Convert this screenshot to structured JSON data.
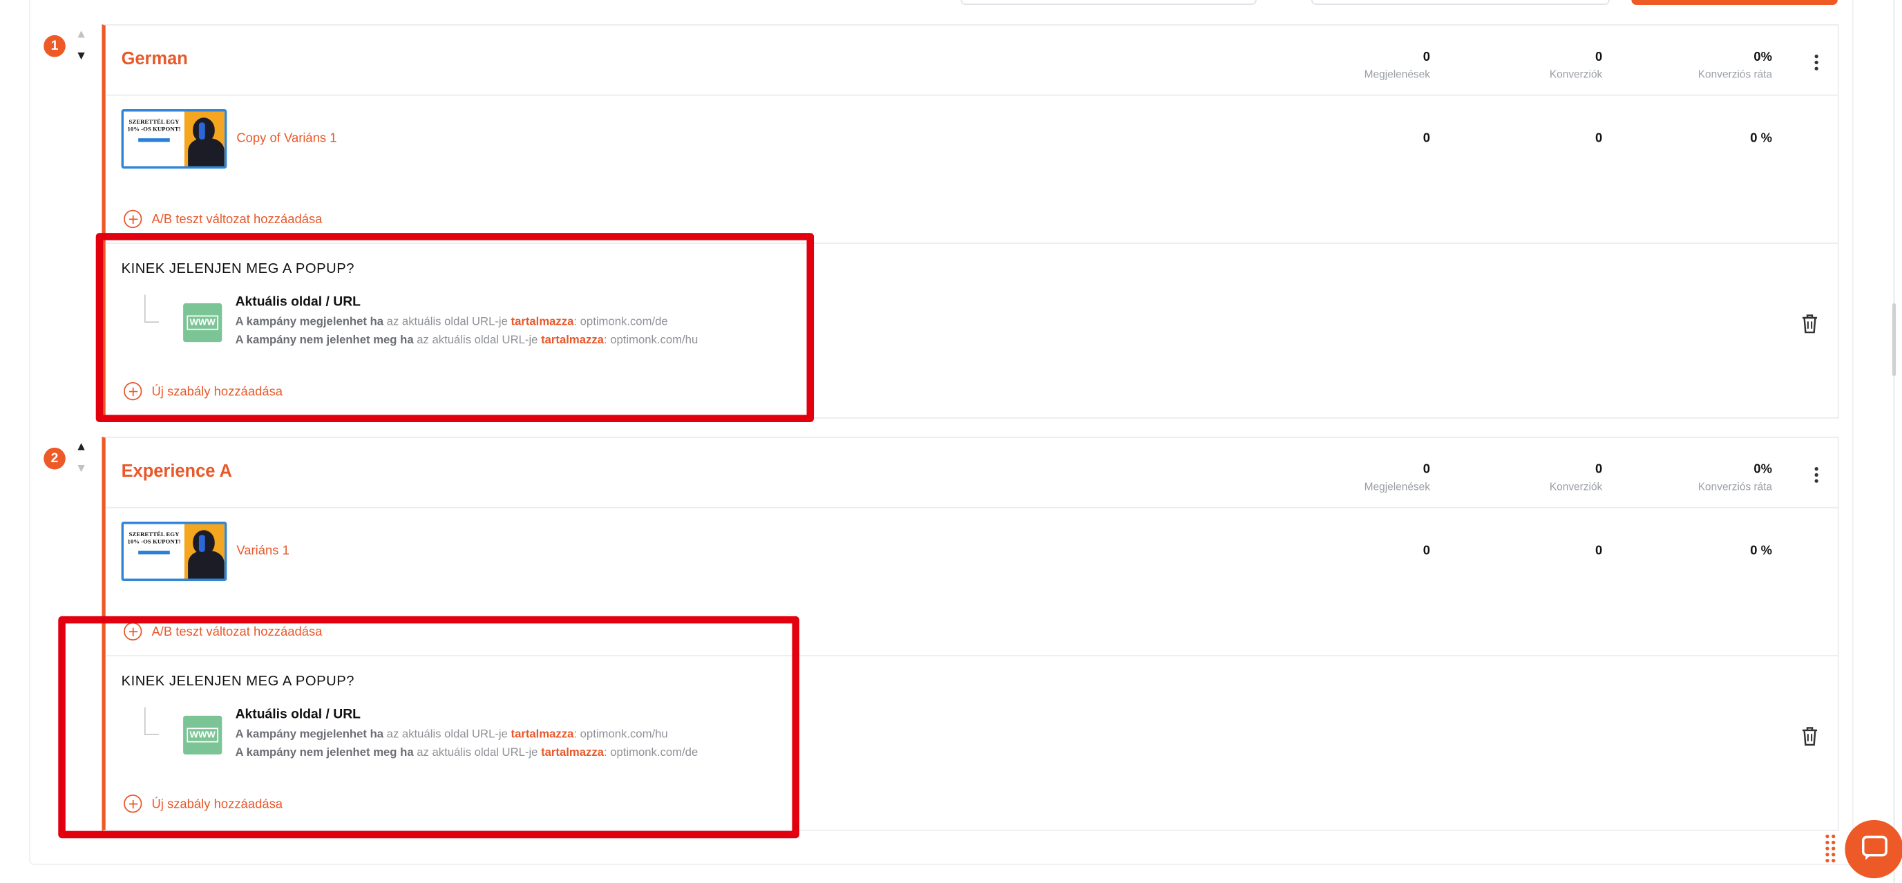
{
  "colors": {
    "accent": "#ED5A27",
    "highlight": "#E2000F",
    "rule_icon": "#7BC495",
    "thumb_border": "#2F86D8"
  },
  "icons": {
    "collapse": "chevron-down-icon",
    "expand": "chevron-up-icon",
    "menu": "kebab-menu-icon",
    "add": "plus-circle-icon",
    "delete": "trash-icon",
    "url_rule": "www-icon",
    "chat": "chat-bubble-icon",
    "drag": "drag-dots-icon"
  },
  "experiences": [
    {
      "index": "1",
      "name": "German",
      "stats": {
        "impressions": "0",
        "impressions_label": "Megjelenések",
        "conversions": "0",
        "conversions_label": "Konverziók",
        "rate": "0%",
        "rate_label": "Konverziós ráta"
      },
      "variant": {
        "name": "Copy of Variáns 1",
        "impressions": "0",
        "conversions": "0",
        "rate": "0 %",
        "thumb_text": "SZERETTÉL EGY 10% -OS KUPONT!"
      },
      "add_ab": "A/B teszt változat hozzáadása",
      "rules_title": "KINEK JELENJEN MEG A POPUP?",
      "rule": {
        "name": "Aktuális oldal / URL",
        "line1_bold": "A kampány megjelenhet ha",
        "line1_mid": " az aktuális oldal URL-je ",
        "line1_op": "tartalmazza",
        "line1_val": ": optimonk.com/de",
        "line2_bold": "A kampány nem jelenhet meg ha",
        "line2_mid": " az aktuális oldal URL-je ",
        "line2_op": "tartalmazza",
        "line2_val": ": optimonk.com/hu"
      },
      "add_rule": "Új szabály hozzáadása"
    },
    {
      "index": "2",
      "name": "Experience A",
      "stats": {
        "impressions": "0",
        "impressions_label": "Megjelenések",
        "conversions": "0",
        "conversions_label": "Konverziók",
        "rate": "0%",
        "rate_label": "Konverziós ráta"
      },
      "variant": {
        "name": "Variáns 1",
        "impressions": "0",
        "conversions": "0",
        "rate": "0 %",
        "thumb_text": "SZERETTÉL EGY 10% -OS KUPONT!"
      },
      "add_ab": "A/B teszt változat hozzáadása",
      "rules_title": "KINEK JELENJEN MEG A POPUP?",
      "rule": {
        "name": "Aktuális oldal / URL",
        "line1_bold": "A kampány megjelenhet ha",
        "line1_mid": " az aktuális oldal URL-je ",
        "line1_op": "tartalmazza",
        "line1_val": ": optimonk.com/hu",
        "line2_bold": "A kampány nem jelenhet meg ha",
        "line2_mid": " az aktuális oldal URL-je ",
        "line2_op": "tartalmazza",
        "line2_val": ": optimonk.com/de"
      },
      "add_rule": "Új szabály hozzáadása"
    }
  ]
}
